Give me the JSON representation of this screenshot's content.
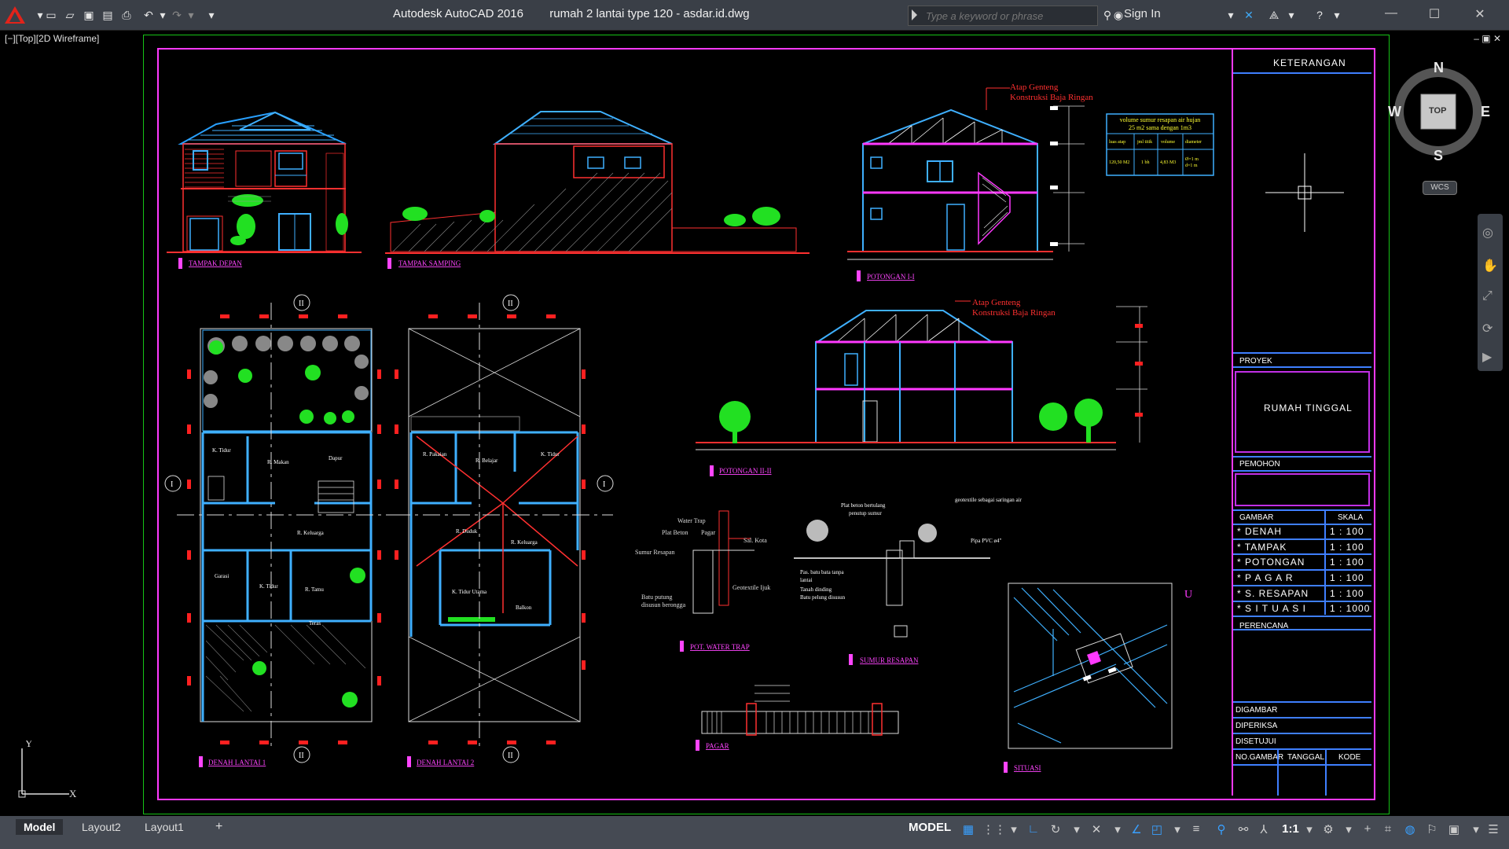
{
  "titlebar": {
    "app_title": "Autodesk AutoCAD 2016",
    "doc_title": "rumah 2 lantai type 120 - asdar.id.dwg",
    "search_placeholder": "Type a keyword or phrase",
    "signin_label": "Sign In"
  },
  "viewport": {
    "label": "[−][Top][2D Wireframe]"
  },
  "compass": {
    "north": "N",
    "south": "S",
    "east": "E",
    "west": "W",
    "top_label": "TOP",
    "wcs_label": "WCS"
  },
  "title_block": {
    "keterangan": "KETERANGAN",
    "proyek_label": "PROYEK",
    "project_name": "RUMAH TINGGAL",
    "pemohon_label": "PEMOHON",
    "gambar_header": "GAMBAR",
    "skala_header": "SKALA",
    "rows": [
      {
        "gambar": "* DENAH",
        "skala": "1 : 100"
      },
      {
        "gambar": "* TAMPAK",
        "skala": "1 : 100"
      },
      {
        "gambar": "* POTONGAN",
        "skala": "1 : 100"
      },
      {
        "gambar": "* P A G A R",
        "skala": "1 : 100"
      },
      {
        "gambar": "* S. RESAPAN",
        "skala": "1 : 100"
      },
      {
        "gambar": "* S I T U A S I",
        "skala": "1 : 1000"
      }
    ],
    "perencana_label": "PERENCANA",
    "digambar": "DIGAMBAR",
    "diperiksa": "DIPERIKSA",
    "disetujui": "DISETUJUI",
    "no_gambar": "NO.GAMBAR",
    "tanggal": "TANGGAL",
    "kode": "KODE"
  },
  "drawing_labels": {
    "tampak_depan": "TAMPAK DEPAN",
    "tampak_samping": "TAMPAK SAMPING",
    "potongan_1": "POTONGAN I-I",
    "potongan_2": "POTONGAN II-II",
    "denah_1": "DENAH LANTAI 1",
    "denah_2": "DENAH LANTAI 2",
    "pot_water_trap": "POT. WATER TRAP",
    "sumur_resapan": "SUMUR RESAPAN",
    "pagar": "PAGAR",
    "situasi": "SITUASI",
    "atap_genteng": "Atap Genteng",
    "konstruksi": "Konstruksi Baja Ringan",
    "sumur_note_1": "volume sumur resapan air hujan",
    "sumur_note_2": "25 m2 sama dengan 1m3",
    "room_ruang_tidur": "K. Tidur",
    "room_makan": "R. Makan",
    "room_dapur": "Dapur",
    "room_keluarga": "R. Keluarga",
    "room_tamu": "R. Tamu",
    "room_garasi": "Garasi",
    "room_teras": "Teras",
    "room_dudsk": "R. Duduk",
    "room_belajar": "R. Belajar",
    "room_pakaian": "R. Pakaian",
    "room_tidur_utama": "K. Tidur Utama",
    "room_balkon": "Balkon"
  },
  "statusbar": {
    "tabs": [
      "Model",
      "Layout2",
      "Layout1"
    ],
    "add_tab": "+",
    "model_button": "MODEL",
    "scale": "1:1"
  },
  "colors": {
    "sheet_border": "#16c216",
    "drawing_border": "#ff39ff",
    "title_lines": "#3f7fff",
    "accent_red": "#ff2020"
  }
}
